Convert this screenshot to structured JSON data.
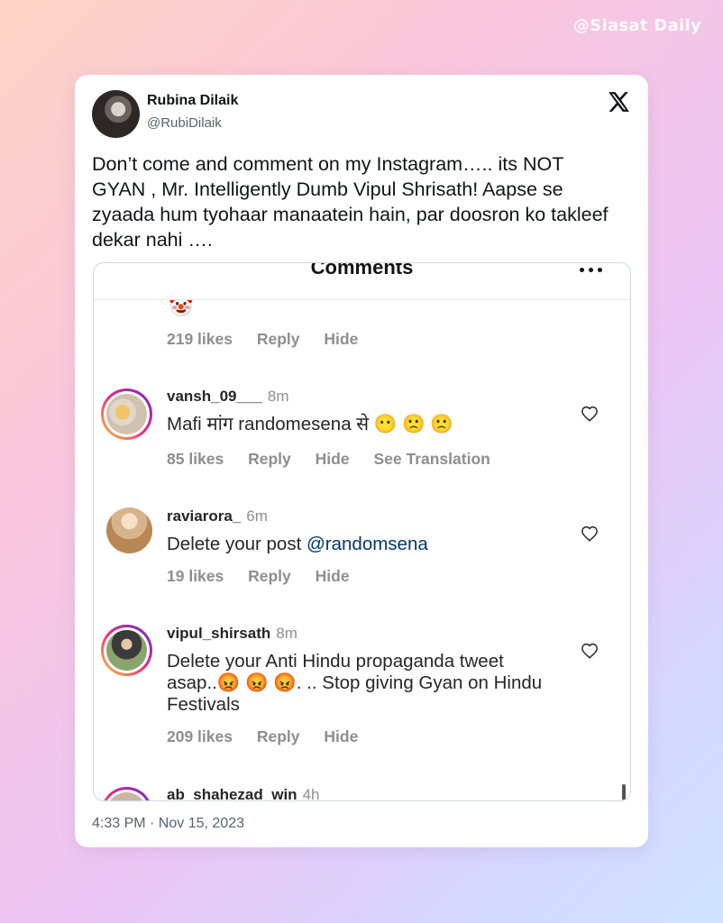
{
  "watermark": "@Siasat Daily",
  "tweet": {
    "author_name": "Rubina Dilaik",
    "author_handle": "@RubiDilaik",
    "text": "Don’t come and comment on my Instagram….. its NOT GYAN , Mr. Intelligently Dumb Vipul Shrisath! Aapse se zyaada hum tyohaar manaatein hain, par doosron ko takleef dekar nahi ….",
    "timestamp": "4:33 PM · Nov 15, 2023",
    "logo_icon": "x-logo-icon"
  },
  "screenshot": {
    "title": "Comments",
    "partial_comment": {
      "emoji": "🤡",
      "likes": "219 likes",
      "reply": "Reply",
      "hide": "Hide"
    },
    "comments": [
      {
        "username": "vansh_09___",
        "time": "8m",
        "text": "Mafi मांग randomesena से 😶 🙁 🙁",
        "likes": "85 likes",
        "reply": "Reply",
        "hide": "Hide",
        "see_translation": "See Translation"
      },
      {
        "username": "raviarora_",
        "time": "6m",
        "text_prefix": "Delete your post ",
        "mention": "@randomsena",
        "likes": "19 likes",
        "reply": "Reply",
        "hide": "Hide"
      },
      {
        "username": "vipul_shirsath",
        "time": "8m",
        "text": "Delete your Anti Hindu propaganda tweet asap..😡 😡 😡. .. Stop giving Gyan on Hindu Festivals",
        "likes": "209 likes",
        "reply": "Reply",
        "hide": "Hide"
      },
      {
        "username": "ab_shahezad_win",
        "time": "4h"
      }
    ]
  },
  "colors": {
    "text_primary": "#0f1419",
    "text_secondary": "#536471",
    "meta_gray": "#8e8e8e",
    "mention_blue": "#00376b"
  }
}
